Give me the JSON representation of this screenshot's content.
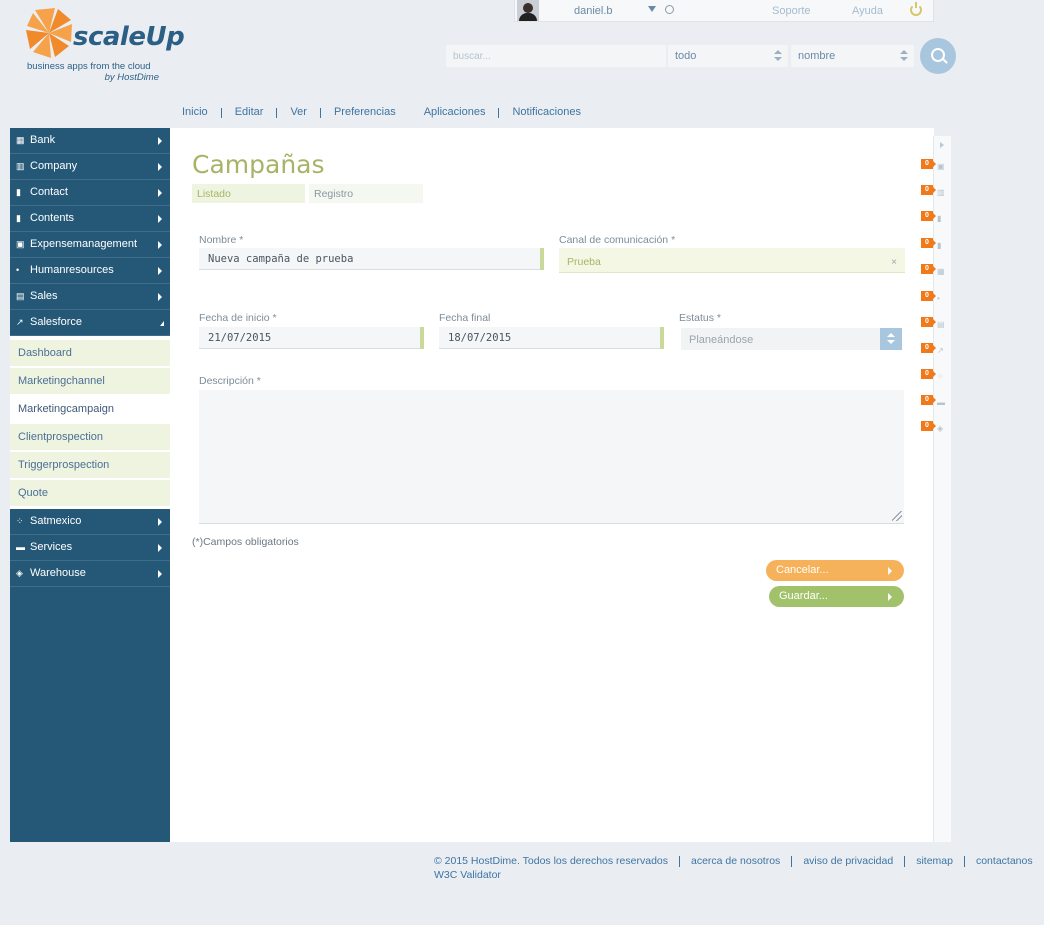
{
  "header": {
    "username": "daniel.b",
    "support": "Soporte",
    "help": "Ayuda"
  },
  "logo": {
    "name": "scaleUp",
    "tagline1": "business apps from the cloud",
    "tagline2": "by HostDime"
  },
  "search": {
    "placeholder": "buscar...",
    "scope": "todo",
    "field": "nombre"
  },
  "topmenu": [
    "Inicio",
    "Editar",
    "Ver",
    "Preferencias",
    "Aplicaciones",
    "Notificaciones"
  ],
  "sidebar": {
    "items": [
      {
        "label": "Bank",
        "icon": "bank-icon"
      },
      {
        "label": "Company",
        "icon": "building-icon"
      },
      {
        "label": "Contact",
        "icon": "contact-book-icon"
      },
      {
        "label": "Contents",
        "icon": "bookmark-icon"
      },
      {
        "label": "Expensemanagement",
        "icon": "money-icon"
      },
      {
        "label": "Humanresources",
        "icon": "people-icon"
      },
      {
        "label": "Sales",
        "icon": "calculator-icon"
      },
      {
        "label": "Salesforce",
        "icon": "trend-icon",
        "expanded": true
      },
      {
        "label": "Satmexico",
        "icon": "grid-icon"
      },
      {
        "label": "Services",
        "icon": "briefcase-icon"
      },
      {
        "label": "Warehouse",
        "icon": "box-icon"
      }
    ],
    "subitems": [
      {
        "label": "Dashboard"
      },
      {
        "label": "Marketingchannel"
      },
      {
        "label": "Marketingcampaign",
        "active": true
      },
      {
        "label": "Clientprospection"
      },
      {
        "label": "Triggerprospection"
      },
      {
        "label": "Quote"
      }
    ]
  },
  "main": {
    "title": "Campañas",
    "tabs": [
      "Listado",
      "Registro"
    ],
    "form": {
      "nombre_label": "Nombre *",
      "nombre_value": "Nueva campaña de prueba",
      "canal_label": "Canal de comunicación *",
      "canal_value": "Prueba",
      "canal_clear": "×",
      "inicio_label": "Fecha de inicio *",
      "inicio_value": "21/07/2015",
      "final_label": "Fecha final",
      "final_value": "18/07/2015",
      "estatus_label": "Estatus *",
      "estatus_value": "Planeándose",
      "descripcion_label": "Descripción *",
      "required_note": "(*)Campos obligatorios"
    },
    "buttons": {
      "cancel": "Cancelar...",
      "save": "Guardar..."
    }
  },
  "notifications": [
    {
      "count": "0",
      "icon": "money-icon"
    },
    {
      "count": "0",
      "icon": "building-icon"
    },
    {
      "count": "0",
      "icon": "contact-book-icon"
    },
    {
      "count": "0",
      "icon": "bookmark-icon"
    },
    {
      "count": "0",
      "icon": "bank-icon"
    },
    {
      "count": "0",
      "icon": "people-icon"
    },
    {
      "count": "0",
      "icon": "calculator-icon"
    },
    {
      "count": "0",
      "icon": "trend-icon"
    },
    {
      "count": "0",
      "icon": "grid-icon"
    },
    {
      "count": "0",
      "icon": "briefcase-icon"
    },
    {
      "count": "0",
      "icon": "box-icon"
    }
  ],
  "footer": {
    "copyright": "© 2015 HostDime. Todos los derechos reservados",
    "about": "acerca de nosotros",
    "privacy": "aviso de privacidad",
    "sitemap": "sitemap",
    "contact": "contactanos",
    "validator": "W3C Validator"
  },
  "colors": {
    "sidebar": "#255877",
    "accent_green": "#a7b468",
    "cancel": "#f5b25a",
    "save": "#a1c26a",
    "badge": "#f07a1a"
  }
}
